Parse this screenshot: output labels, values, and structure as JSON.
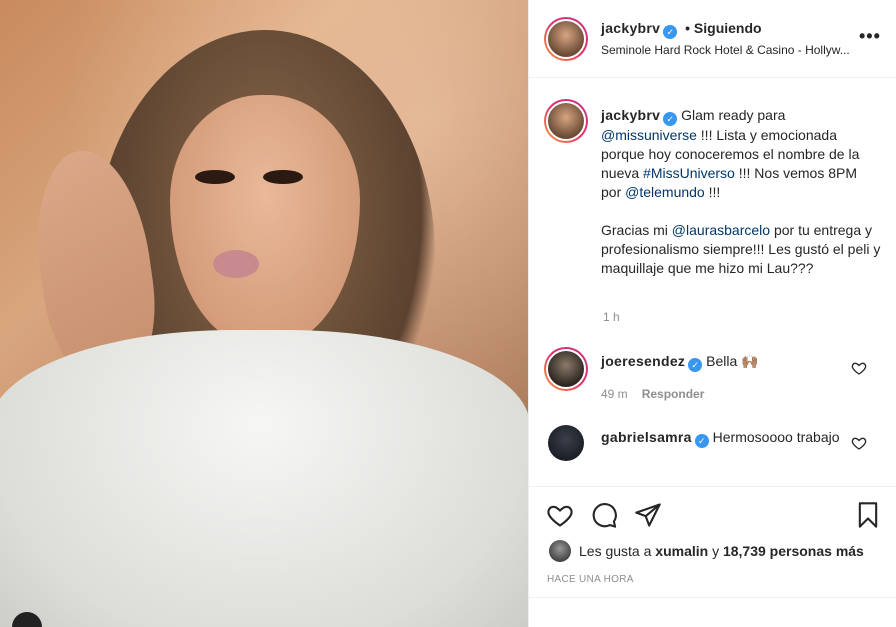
{
  "post": {
    "username": "jackybrv",
    "follow_status": "• Siguiendo",
    "location": "Seminole Hard Rock Hotel & Casino - Hollyw...",
    "caption": {
      "lead": "Glam ready para",
      "mention_missuniverse": "@missuniverse",
      "text_1": "!!! Lista y emocionada porque hoy conoceremos el nombre de la nueva",
      "hashtag": "#MissUniverso",
      "text_2": "!!! Nos vemos 8PM por",
      "mention_telemundo": "@telemundo",
      "text_3": "!!!",
      "para2_lead": "Gracias mi",
      "mention_laura": "@laurasbarcelo",
      "para2_rest": "por tu entrega y profesionalismo siempre!!! Les gustó el peli y maquillaje que me hizo mi Lau???"
    },
    "caption_time": "1 h"
  },
  "comments": [
    {
      "username": "joeresendez",
      "text": "Bella 🙌🏽",
      "time": "49 m",
      "reply_label": "Responder"
    },
    {
      "username": "gabrielsamra",
      "text": "Hermosoooo trabajo"
    }
  ],
  "actions": {
    "like_icon": "heart-icon",
    "comment_icon": "comment-icon",
    "share_icon": "paper-plane-icon",
    "save_icon": "bookmark-icon"
  },
  "likes": {
    "prefix": "Les gusta a",
    "user": "xumalin",
    "connector": "y",
    "count": "18,739 personas más"
  },
  "posted_ago": "HACE UNA HORA",
  "colors": {
    "link": "#00376b",
    "verified": "#3897f0",
    "muted": "#8e8e8e"
  }
}
